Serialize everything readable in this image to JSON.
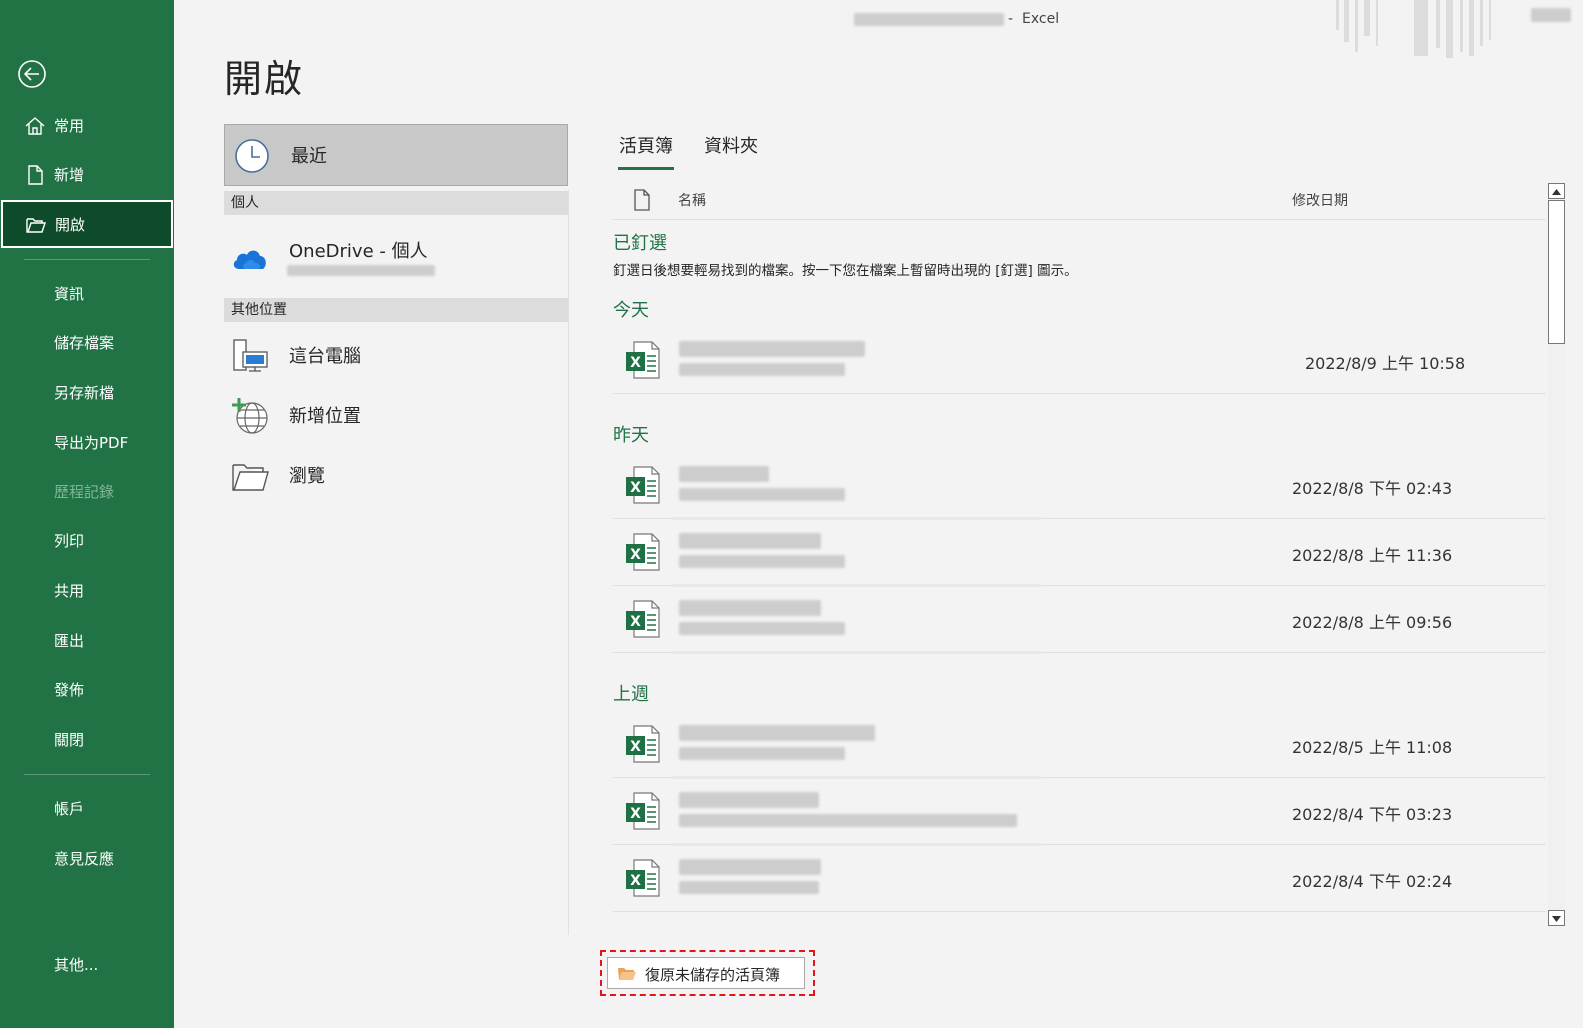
{
  "window": {
    "app_name": "Excel",
    "separator": "-"
  },
  "page_title": "開啟",
  "sidebar": {
    "items": [
      {
        "label": "常用",
        "icon": "home-icon"
      },
      {
        "label": "新增",
        "icon": "new-document-icon"
      },
      {
        "label": "開啟",
        "icon": "open-folder-icon",
        "active": true
      },
      {
        "label": "資訊"
      },
      {
        "label": "儲存檔案"
      },
      {
        "label": "另存新檔"
      },
      {
        "label": "导出为PDF"
      },
      {
        "label": "歷程記錄",
        "disabled": true
      },
      {
        "label": "列印"
      },
      {
        "label": "共用"
      },
      {
        "label": "匯出"
      },
      {
        "label": "發佈"
      },
      {
        "label": "關閉"
      },
      {
        "label": "帳戶"
      },
      {
        "label": "意見反應"
      },
      {
        "label": "其他..."
      }
    ]
  },
  "locations": {
    "recent": "最近",
    "group_personal": "個人",
    "onedrive": "OneDrive - 個人",
    "group_other": "其他位置",
    "this_pc": "這台電腦",
    "add_place": "新增位置",
    "browse": "瀏覽"
  },
  "tabs": {
    "workbooks": "活頁簿",
    "folders": "資料夾"
  },
  "list": {
    "header_name": "名稱",
    "header_date": "修改日期",
    "pinned_title": "已釘選",
    "pinned_desc": "釘選日後想要輕易找到的檔案。按一下您在檔案上暫留時出現的 [釘選] 圖示。",
    "today_title": "今天",
    "yesterday_title": "昨天",
    "lastweek_title": "上週",
    "today": [
      {
        "date": "2022/8/9 上午 10:58"
      }
    ],
    "yesterday": [
      {
        "date": "2022/8/8 下午 02:43"
      },
      {
        "date": "2022/8/8 上午 11:36"
      },
      {
        "date": "2022/8/8 上午 09:56"
      }
    ],
    "lastweek": [
      {
        "date": "2022/8/5 上午 11:08"
      },
      {
        "date": "2022/8/4 下午 03:23"
      },
      {
        "date": "2022/8/4 下午 02:24"
      }
    ]
  },
  "recover_button": "復原未儲存的活頁簿",
  "colors": {
    "brand_green": "#217346",
    "active_nav": "#0e4b2a",
    "highlight_red": "#e0161a"
  }
}
